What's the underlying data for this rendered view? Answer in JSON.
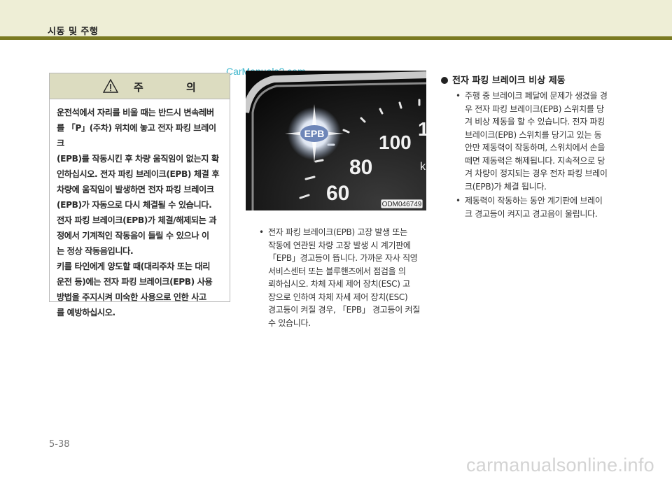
{
  "header": {
    "section_label": "시동 및 주행"
  },
  "watermark_top": "CarManuals2.com",
  "caution": {
    "title": "주 의",
    "lines": [
      "운전석에서 자리를 비울 때는 반드시 변속레버",
      "를 「P」(주차) 위치에 놓고 전자 파킹 브레이크",
      "(EPB)를 작동시킨 후 차량 움직임이 없는지 확",
      "인하십시오. 전자 파킹 브레이크(EPB) 체결 후",
      "차량에 움직임이 발생하면 전자 파킹 브레이크",
      "(EPB)가 자동으로 다시 체결될 수 있습니다.",
      "전자 파킹 브레이크(EPB)가 체결/해제되는 과",
      "정에서 기계적인 작동음이 들릴 수 있으나 이",
      "는 정상 작동음입니다.",
      "키를 타인에게 양도할 때(대리주차 또는 대리",
      "운전 등)에는 전자 파킹 브레이크(EPB) 사용",
      "방법을 주지시켜 미숙한 사용으로 인한 사고",
      "를 예방하십시오."
    ]
  },
  "gauge": {
    "epb_label": "EPB",
    "speeds": [
      "60",
      "80",
      "100",
      "1"
    ],
    "unit_fragment": "k",
    "image_code": "ODM046749"
  },
  "mid_list": {
    "items": [
      {
        "bullet": "•",
        "lines": [
          "전자 파킹 브레이크(EPB) 고장 발생 또는",
          "작동에 연관된 차량 고장 발생 시 계기판에",
          "「EPB」경고등이 뜹니다. 가까운 자사 직영",
          "서비스센터 또는 블루핸즈에서 점검을 의",
          "뢰하십시오. 차체 자세 제어 장치(ESC) 고",
          "장으로 인하여 차체 자세 제어 장치(ESC)",
          "경고등이 켜질 경우, 「EPB」 경고등이 켜질",
          "수 있습니다."
        ]
      }
    ]
  },
  "right_section": {
    "heading": "전자 파킹 브레이크 비상 제동",
    "items": [
      {
        "bullet": "•",
        "lines": [
          "주행 중 브레이크 페달에 문제가 생겼을 경",
          "우 전자 파킹 브레이크(EPB) 스위치를 당",
          "겨 비상 제동을 할 수 있습니다. 전자 파킹",
          "브레이크(EPB) 스위치를 당기고 있는 동",
          "안만 제동력이 작동하며, 스위치에서 손을",
          "떼면 제동력은 해제됩니다. 지속적으로 당",
          "겨 차량이 정지되는 경우 전자 파킹 브레이",
          "크(EPB)가 체결 됩니다."
        ]
      },
      {
        "bullet": "•",
        "lines": [
          "제동력이 작동하는 동안 계기판에 브레이",
          "크 경고등이 켜지고 경고음이 울립니다."
        ]
      }
    ]
  },
  "page_number": "5-38",
  "watermark_bottom": "carmanualsonline.info"
}
